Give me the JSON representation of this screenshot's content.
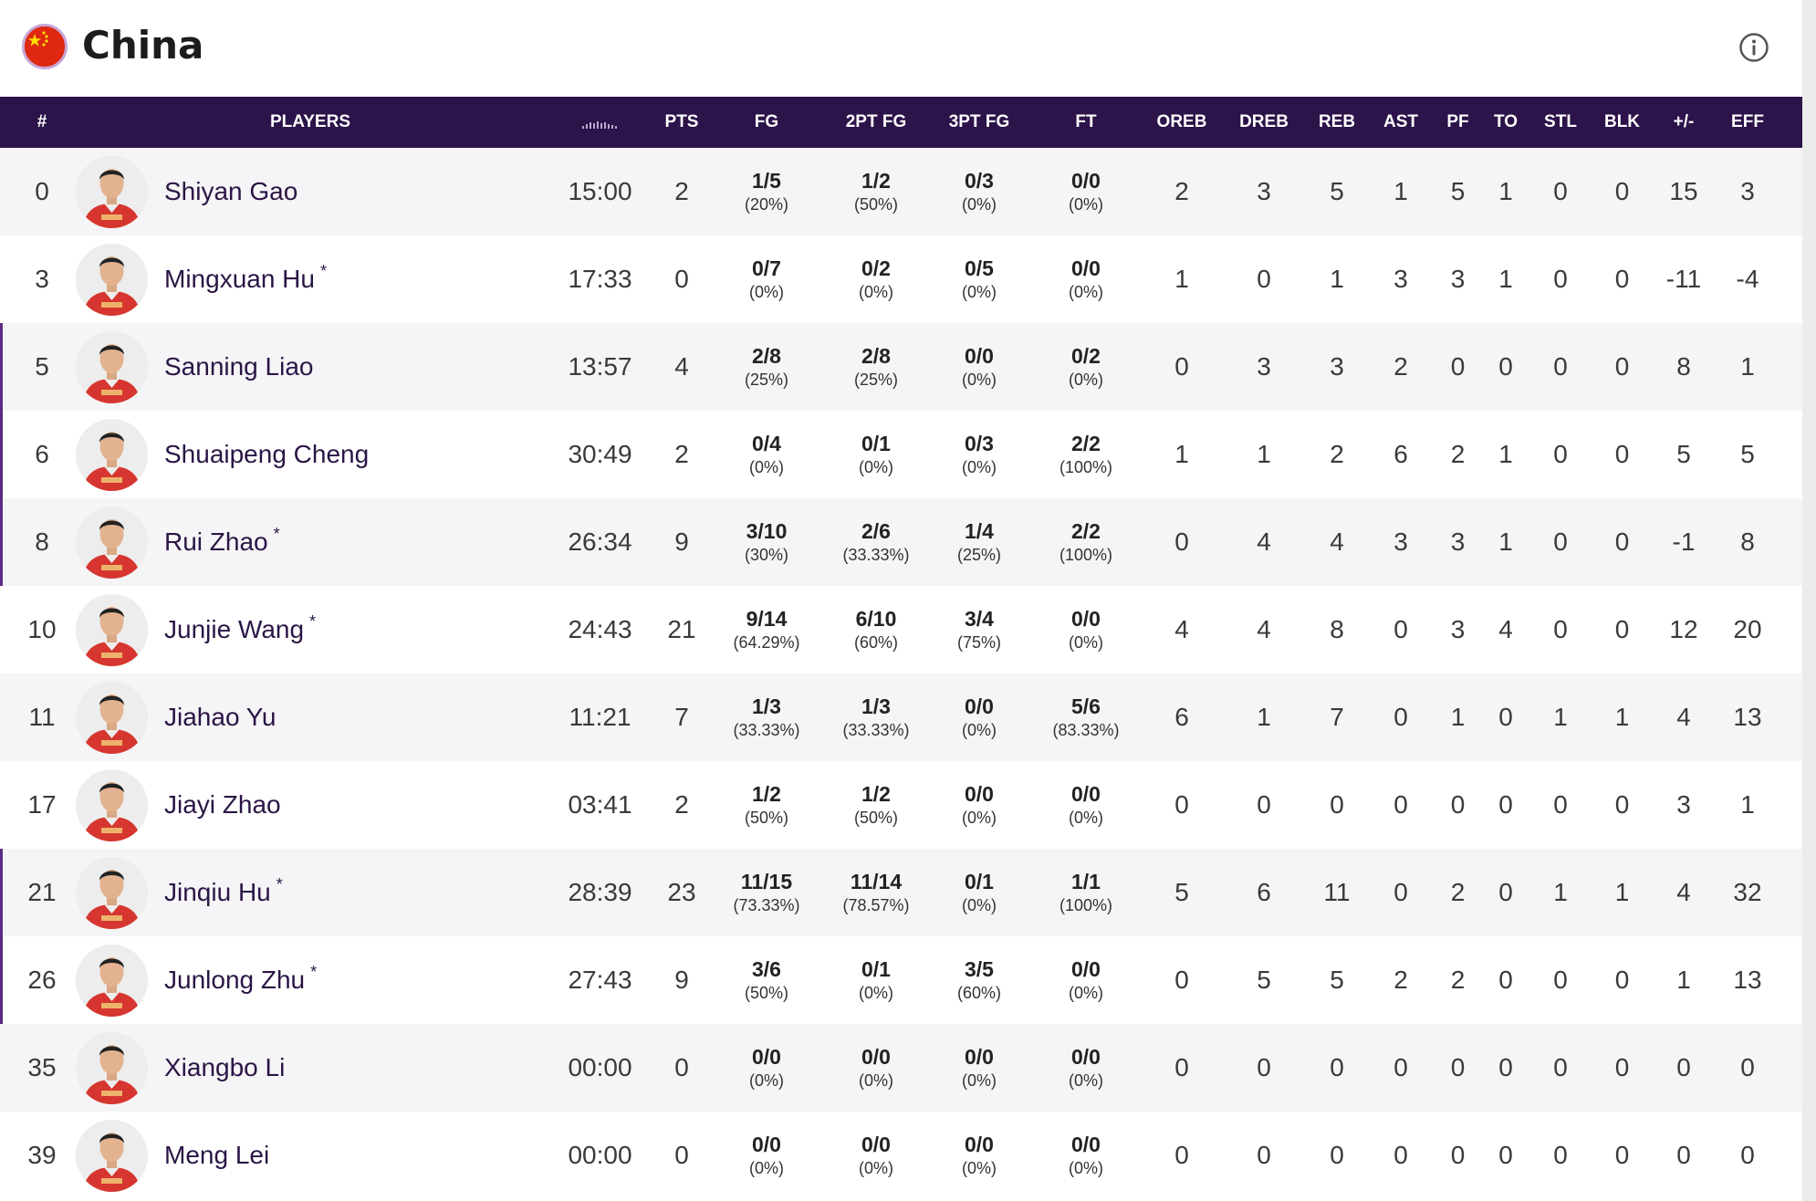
{
  "team": {
    "name": "China",
    "flag_icon": "china-flag-icon",
    "info_icon": "info-icon"
  },
  "colors": {
    "header_bg": "#2c1349",
    "accent": "#5b2b84",
    "row_alt": "#f5f4f6",
    "jersey": "#d6362f"
  },
  "columns": {
    "number": "#",
    "players": "PLAYERS",
    "minutes_icon": "minutes-icon",
    "pts": "PTS",
    "fg": "FG",
    "fg2": "2PT FG",
    "fg3": "3PT FG",
    "ft": "FT",
    "oreb": "OREB",
    "dreb": "DREB",
    "reb": "REB",
    "ast": "AST",
    "pf": "PF",
    "to": "TO",
    "stl": "STL",
    "blk": "BLK",
    "pm": "+/-",
    "eff": "EFF"
  },
  "players": [
    {
      "number": "0",
      "name": "Shiyan Gao",
      "starter": "",
      "min": "15:00",
      "pts": "2",
      "fg": [
        "1/5",
        "(20%)"
      ],
      "fg2": [
        "1/2",
        "(50%)"
      ],
      "fg3": [
        "0/3",
        "(0%)"
      ],
      "ft": [
        "0/0",
        "(0%)"
      ],
      "oreb": "2",
      "dreb": "3",
      "reb": "5",
      "ast": "1",
      "pf": "5",
      "to": "1",
      "stl": "0",
      "blk": "0",
      "pm": "15",
      "eff": "3",
      "marked": false
    },
    {
      "number": "3",
      "name": "Mingxuan Hu",
      "starter": "*",
      "min": "17:33",
      "pts": "0",
      "fg": [
        "0/7",
        "(0%)"
      ],
      "fg2": [
        "0/2",
        "(0%)"
      ],
      "fg3": [
        "0/5",
        "(0%)"
      ],
      "ft": [
        "0/0",
        "(0%)"
      ],
      "oreb": "1",
      "dreb": "0",
      "reb": "1",
      "ast": "3",
      "pf": "3",
      "to": "1",
      "stl": "0",
      "blk": "0",
      "pm": "-11",
      "eff": "-4",
      "marked": false
    },
    {
      "number": "5",
      "name": "Sanning Liao",
      "starter": "",
      "min": "13:57",
      "pts": "4",
      "fg": [
        "2/8",
        "(25%)"
      ],
      "fg2": [
        "2/8",
        "(25%)"
      ],
      "fg3": [
        "0/0",
        "(0%)"
      ],
      "ft": [
        "0/2",
        "(0%)"
      ],
      "oreb": "0",
      "dreb": "3",
      "reb": "3",
      "ast": "2",
      "pf": "0",
      "to": "0",
      "stl": "0",
      "blk": "0",
      "pm": "8",
      "eff": "1",
      "marked": true
    },
    {
      "number": "6",
      "name": "Shuaipeng Cheng",
      "starter": "",
      "min": "30:49",
      "pts": "2",
      "fg": [
        "0/4",
        "(0%)"
      ],
      "fg2": [
        "0/1",
        "(0%)"
      ],
      "fg3": [
        "0/3",
        "(0%)"
      ],
      "ft": [
        "2/2",
        "(100%)"
      ],
      "oreb": "1",
      "dreb": "1",
      "reb": "2",
      "ast": "6",
      "pf": "2",
      "to": "1",
      "stl": "0",
      "blk": "0",
      "pm": "5",
      "eff": "5",
      "marked": true
    },
    {
      "number": "8",
      "name": "Rui Zhao",
      "starter": "*",
      "min": "26:34",
      "pts": "9",
      "fg": [
        "3/10",
        "(30%)"
      ],
      "fg2": [
        "2/6",
        "(33.33%)"
      ],
      "fg3": [
        "1/4",
        "(25%)"
      ],
      "ft": [
        "2/2",
        "(100%)"
      ],
      "oreb": "0",
      "dreb": "4",
      "reb": "4",
      "ast": "3",
      "pf": "3",
      "to": "1",
      "stl": "0",
      "blk": "0",
      "pm": "-1",
      "eff": "8",
      "marked": true
    },
    {
      "number": "10",
      "name": "Junjie Wang",
      "starter": "*",
      "min": "24:43",
      "pts": "21",
      "fg": [
        "9/14",
        "(64.29%)"
      ],
      "fg2": [
        "6/10",
        "(60%)"
      ],
      "fg3": [
        "3/4",
        "(75%)"
      ],
      "ft": [
        "0/0",
        "(0%)"
      ],
      "oreb": "4",
      "dreb": "4",
      "reb": "8",
      "ast": "0",
      "pf": "3",
      "to": "4",
      "stl": "0",
      "blk": "0",
      "pm": "12",
      "eff": "20",
      "marked": false
    },
    {
      "number": "11",
      "name": "Jiahao Yu",
      "starter": "",
      "min": "11:21",
      "pts": "7",
      "fg": [
        "1/3",
        "(33.33%)"
      ],
      "fg2": [
        "1/3",
        "(33.33%)"
      ],
      "fg3": [
        "0/0",
        "(0%)"
      ],
      "ft": [
        "5/6",
        "(83.33%)"
      ],
      "oreb": "6",
      "dreb": "1",
      "reb": "7",
      "ast": "0",
      "pf": "1",
      "to": "0",
      "stl": "1",
      "blk": "1",
      "pm": "4",
      "eff": "13",
      "marked": false
    },
    {
      "number": "17",
      "name": "Jiayi Zhao",
      "starter": "",
      "min": "03:41",
      "pts": "2",
      "fg": [
        "1/2",
        "(50%)"
      ],
      "fg2": [
        "1/2",
        "(50%)"
      ],
      "fg3": [
        "0/0",
        "(0%)"
      ],
      "ft": [
        "0/0",
        "(0%)"
      ],
      "oreb": "0",
      "dreb": "0",
      "reb": "0",
      "ast": "0",
      "pf": "0",
      "to": "0",
      "stl": "0",
      "blk": "0",
      "pm": "3",
      "eff": "1",
      "marked": false
    },
    {
      "number": "21",
      "name": "Jinqiu Hu",
      "starter": "*",
      "min": "28:39",
      "pts": "23",
      "fg": [
        "11/15",
        "(73.33%)"
      ],
      "fg2": [
        "11/14",
        "(78.57%)"
      ],
      "fg3": [
        "0/1",
        "(0%)"
      ],
      "ft": [
        "1/1",
        "(100%)"
      ],
      "oreb": "5",
      "dreb": "6",
      "reb": "11",
      "ast": "0",
      "pf": "2",
      "to": "0",
      "stl": "1",
      "blk": "1",
      "pm": "4",
      "eff": "32",
      "marked": true
    },
    {
      "number": "26",
      "name": "Junlong Zhu",
      "starter": "*",
      "min": "27:43",
      "pts": "9",
      "fg": [
        "3/6",
        "(50%)"
      ],
      "fg2": [
        "0/1",
        "(0%)"
      ],
      "fg3": [
        "3/5",
        "(60%)"
      ],
      "ft": [
        "0/0",
        "(0%)"
      ],
      "oreb": "0",
      "dreb": "5",
      "reb": "5",
      "ast": "2",
      "pf": "2",
      "to": "0",
      "stl": "0",
      "blk": "0",
      "pm": "1",
      "eff": "13",
      "marked": true
    },
    {
      "number": "35",
      "name": "Xiangbo Li",
      "starter": "",
      "min": "00:00",
      "pts": "0",
      "fg": [
        "0/0",
        "(0%)"
      ],
      "fg2": [
        "0/0",
        "(0%)"
      ],
      "fg3": [
        "0/0",
        "(0%)"
      ],
      "ft": [
        "0/0",
        "(0%)"
      ],
      "oreb": "0",
      "dreb": "0",
      "reb": "0",
      "ast": "0",
      "pf": "0",
      "to": "0",
      "stl": "0",
      "blk": "0",
      "pm": "0",
      "eff": "0",
      "marked": false
    },
    {
      "number": "39",
      "name": "Meng Lei",
      "starter": "",
      "min": "00:00",
      "pts": "0",
      "fg": [
        "0/0",
        "(0%)"
      ],
      "fg2": [
        "0/0",
        "(0%)"
      ],
      "fg3": [
        "0/0",
        "(0%)"
      ],
      "ft": [
        "0/0",
        "(0%)"
      ],
      "oreb": "0",
      "dreb": "0",
      "reb": "0",
      "ast": "0",
      "pf": "0",
      "to": "0",
      "stl": "0",
      "blk": "0",
      "pm": "0",
      "eff": "0",
      "marked": false
    }
  ]
}
